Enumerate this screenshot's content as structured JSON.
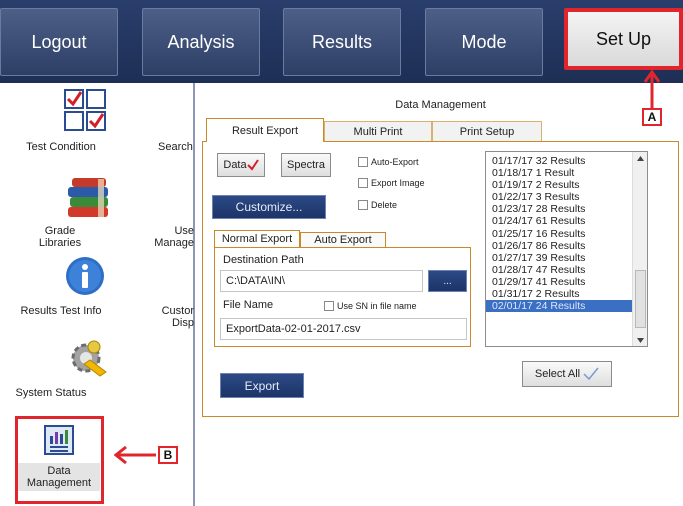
{
  "nav": {
    "logout": "Logout",
    "analysis": "Analysis",
    "results": "Results",
    "mode": "Mode",
    "setup": "Set Up"
  },
  "sidebar": {
    "test_condition": "Test Condition",
    "search_partial": "Search",
    "grade_libraries": "Grade Libraries",
    "user_management_partial": [
      "Use",
      "Manage"
    ],
    "results_test_info": "Results Test Info",
    "custom_display_partial": [
      "Custor",
      "Disp"
    ],
    "system_status": "System Status",
    "data_management": "Data Management"
  },
  "panel": {
    "title": "Data Management",
    "tabs": [
      "Result Export",
      "Multi Print",
      "Print Setup"
    ],
    "active_tab": "Result Export",
    "buttons": {
      "data": "Data",
      "spectra": "Spectra",
      "customize": "Customize...",
      "export": "Export",
      "browse": "...",
      "select_all": "Select All"
    },
    "checkboxes": {
      "auto_export": "Auto-Export",
      "export_image": "Export Image",
      "delete": "Delete",
      "use_sn": "Use SN in file name"
    },
    "subtabs": [
      "Normal Export",
      "Auto Export"
    ],
    "destination_label": "Destination Path",
    "destination_value": "C:\\DATA\\IN\\",
    "filename_label": "File Name",
    "filename_value": "ExportData-02-01-2017.csv",
    "results_list": [
      "01/17/17 32 Results",
      "01/18/17 1 Result",
      "01/19/17 2 Results",
      "01/22/17 3 Results",
      "01/23/17 28 Results",
      "01/24/17 61 Results",
      "01/25/17 16 Results",
      "01/26/17 86 Results",
      "01/27/17 39 Results",
      "01/28/17 47 Results",
      "01/29/17 41 Results",
      "01/31/17 2 Results",
      "02/01/17 24 Results"
    ],
    "selected_result": "02/01/17 24 Results"
  },
  "callouts": {
    "a": "A",
    "b": "B"
  },
  "colors": {
    "highlight": "#e0262c",
    "nav": "#2e3f66",
    "selection": "#3a6fc4",
    "frame": "#c88a28"
  }
}
